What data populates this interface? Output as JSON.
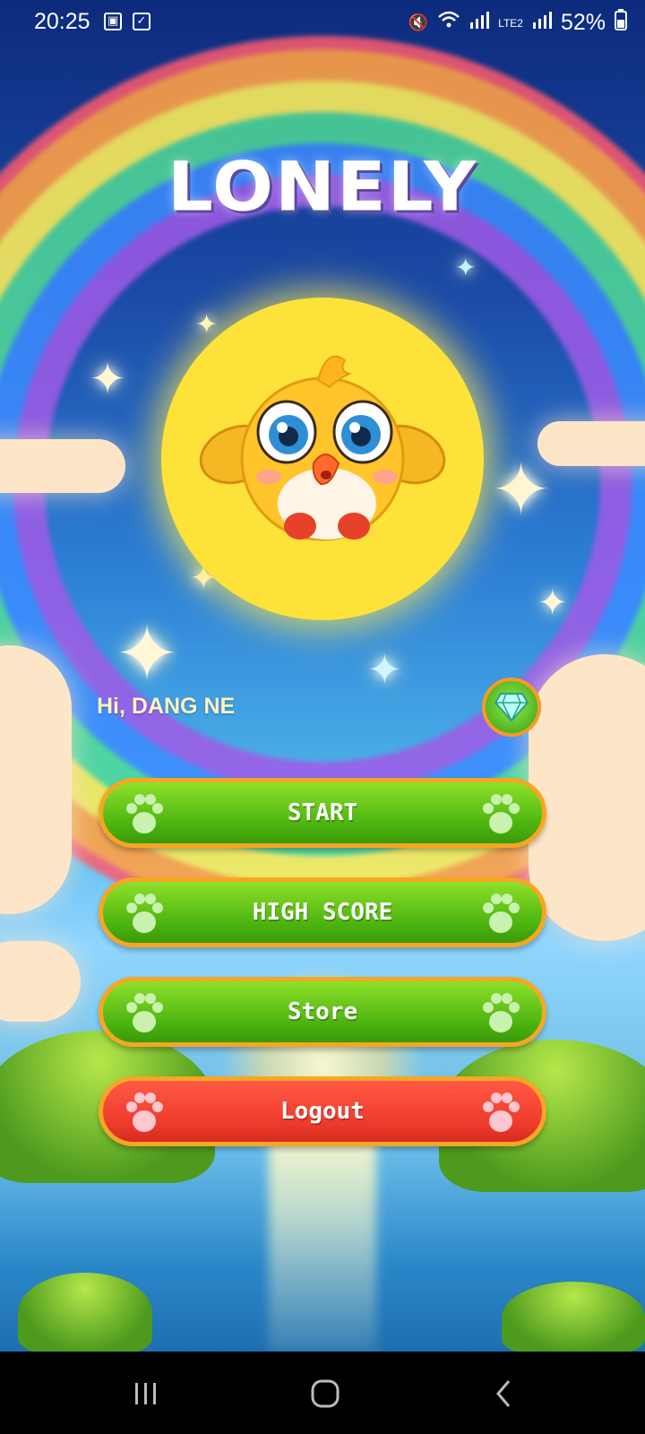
{
  "status_bar": {
    "time": "20:25",
    "battery": "52%",
    "network_label": "LTE2"
  },
  "app": {
    "title": "LONELY"
  },
  "user": {
    "greeting": "Hi, DANG NE"
  },
  "menu": {
    "start_label": "START",
    "high_score_label": "HIGH SCORE",
    "store_label": "Store",
    "logout_label": "Logout"
  },
  "icons": {
    "gem": "diamond-icon",
    "paw": "paw-icon",
    "nav_recent": "recent-apps-icon",
    "nav_home": "home-icon",
    "nav_back": "back-icon"
  },
  "colors": {
    "button_green": "#5cc516",
    "button_red": "#f2412f",
    "button_border": "#f6a623",
    "avatar_bg": "#fde23a"
  }
}
